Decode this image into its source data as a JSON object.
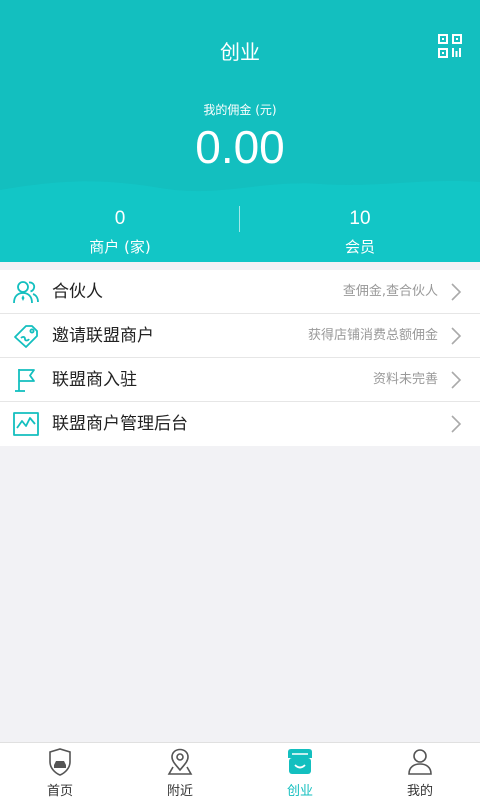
{
  "header": {
    "title": "创业",
    "qr_icon": "qr-code-icon",
    "commission_label": "我的佣金 (元)",
    "commission_value": "0.00",
    "bg_color": "#13bfbf"
  },
  "stats": {
    "merchants": {
      "value": "0",
      "label": "商户 (家)"
    },
    "members": {
      "value": "10",
      "label": "会员"
    }
  },
  "menu": [
    {
      "label": "合伙人",
      "hint": "查佣金,查合伙人",
      "icon": "partners-icon"
    },
    {
      "label": "邀请联盟商户",
      "hint": "获得店铺消费总额佣金",
      "icon": "invite-tag-icon"
    },
    {
      "label": "联盟商入驻",
      "hint": "资料未完善",
      "icon": "flag-icon"
    },
    {
      "label": "联盟商户管理后台",
      "hint": "",
      "icon": "chart-icon"
    }
  ],
  "tabs": [
    {
      "label": "首页",
      "icon": "home-shield-icon",
      "active": false
    },
    {
      "label": "附近",
      "icon": "location-pin-icon",
      "active": false
    },
    {
      "label": "创业",
      "icon": "store-icon",
      "active": true
    },
    {
      "label": "我的",
      "icon": "user-icon",
      "active": false
    }
  ],
  "colors": {
    "accent": "#13bfbf",
    "hint_text": "#999999"
  }
}
